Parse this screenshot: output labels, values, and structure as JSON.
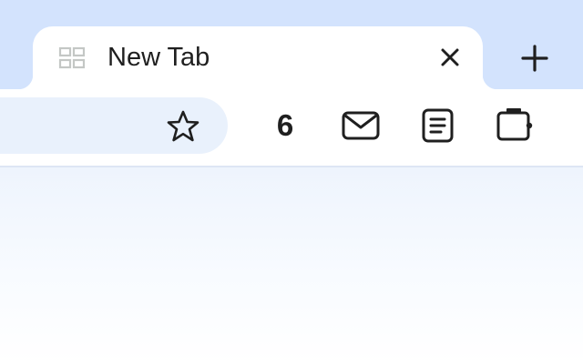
{
  "tab": {
    "title": "New Tab",
    "icon": "grid-icon",
    "close_icon": "close-icon"
  },
  "new_tab_icon": "plus-icon",
  "toolbar": {
    "bookmark_icon": "star-icon",
    "extensions_count": "6",
    "extensions": [
      "mail-icon",
      "notes-icon",
      "wallet-icon"
    ]
  },
  "colors": {
    "tabstrip": "#d3e3fd",
    "omnibox": "#e9f1fc",
    "text": "#1f1f1f",
    "tab_icon": "#c4c7c5"
  }
}
